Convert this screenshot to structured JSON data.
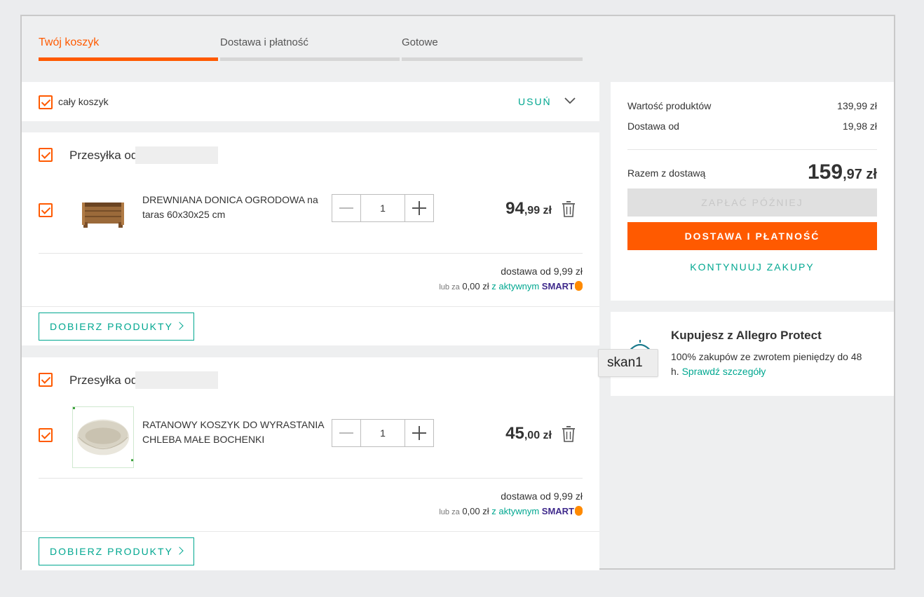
{
  "steps": [
    {
      "label": "Twój koszyk",
      "active": true
    },
    {
      "label": "Dostawa i płatność",
      "active": false
    },
    {
      "label": "Gotowe",
      "active": false
    }
  ],
  "cart_header": {
    "select_all_label": "cały koszyk",
    "remove_label": "USUŃ"
  },
  "shipments": [
    {
      "from_label": "Przesyłka od",
      "product": {
        "name": "DREWNIANA DONICA OGRODOWA na taras 60x30x25 cm",
        "quantity": "1",
        "price_main": "94",
        "price_cents": ",99 zł"
      },
      "delivery": "dostawa od 9,99 zł",
      "smart": {
        "lub": "lub za",
        "amount": "0,00 zł",
        "mid": "z aktywnym",
        "brand": "SMART"
      },
      "match_button": "DOBIERZ PRODUKTY"
    },
    {
      "from_label": "Przesyłka od",
      "product": {
        "name": "RATANOWY KOSZYK DO WYRASTANIA CHLEBA MAŁE BOCHENKI",
        "quantity": "1",
        "price_main": "45",
        "price_cents": ",00 zł"
      },
      "delivery": "dostawa od 9,99 zł",
      "smart": {
        "lub": "lub za",
        "amount": "0,00 zł",
        "mid": "z aktywnym",
        "brand": "SMART"
      },
      "match_button": "DOBIERZ PRODUKTY"
    }
  ],
  "summary": {
    "products_label": "Wartość produktów",
    "products_value": "139,99 zł",
    "shipping_label": "Dostawa od",
    "shipping_value": "19,98 zł",
    "total_label": "Razem z dostawą",
    "total_main": "159",
    "total_cents": ",97",
    "total_currency": " zł",
    "pay_later": "ZAPŁAĆ PÓŹNIEJ",
    "checkout": "DOSTAWA I PŁATNOŚĆ",
    "continue": "KONTYNUUJ ZAKUPY"
  },
  "protect": {
    "title": "Kupujesz z Allegro Protect",
    "text": "100% zakupów ze zwrotem pieniędzy do",
    "text2": "48 h.",
    "link": "Sprawdź szczegóły"
  },
  "tooltip": "skan1",
  "colors": {
    "accent": "#ff5a00",
    "link": "#00a790",
    "smart": "#3f2a8c"
  }
}
